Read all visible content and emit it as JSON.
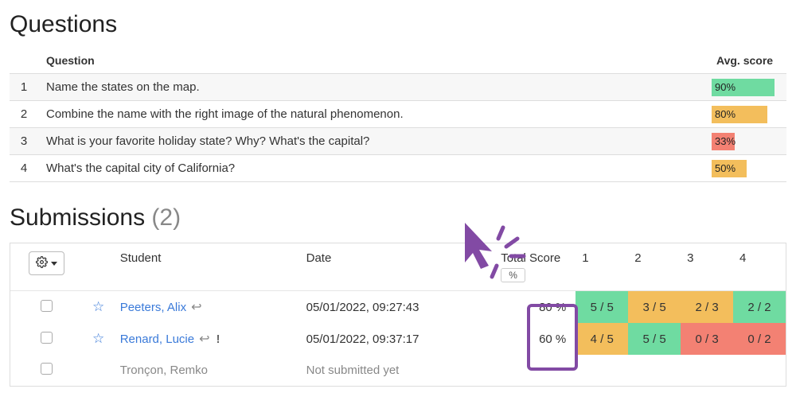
{
  "questions": {
    "heading": "Questions",
    "columns": {
      "question": "Question",
      "avg": "Avg. score"
    },
    "rows": [
      {
        "n": "1",
        "text": "Name the states on the map.",
        "avg": "90%",
        "pct": 90,
        "cls": "c-green"
      },
      {
        "n": "2",
        "text": "Combine the name with the right image of the natural phenomenon.",
        "avg": "80%",
        "pct": 80,
        "cls": "c-orange"
      },
      {
        "n": "3",
        "text": "What is your favorite holiday state? Why? What's the capital?",
        "avg": "33%",
        "pct": 33,
        "cls": "c-red"
      },
      {
        "n": "4",
        "text": "What's the capital city of California?",
        "avg": "50%",
        "pct": 50,
        "cls": "c-orange"
      }
    ]
  },
  "submissions": {
    "heading_prefix": "Submissions ",
    "count_display": "(2)",
    "columns": {
      "student": "Student",
      "date": "Date",
      "total": "Total Score",
      "percent_toggle": "%",
      "q1": "1",
      "q2": "2",
      "q3": "3",
      "q4": "4"
    },
    "rows": [
      {
        "student": "Peeters, Alix",
        "date": "05/01/2022, 09:27:43",
        "total": "80 %",
        "scores": [
          {
            "v": "5 / 5",
            "cls": "c-green"
          },
          {
            "v": "3 / 5",
            "cls": "c-orange"
          },
          {
            "v": "2 / 3",
            "cls": "c-orange"
          },
          {
            "v": "2 / 2",
            "cls": "c-green"
          }
        ],
        "warn": false
      },
      {
        "student": "Renard, Lucie",
        "date": "05/01/2022, 09:37:17",
        "total": "60 %",
        "scores": [
          {
            "v": "4 / 5",
            "cls": "c-orange"
          },
          {
            "v": "5 / 5",
            "cls": "c-green"
          },
          {
            "v": "0 / 3",
            "cls": "c-red"
          },
          {
            "v": "0 / 2",
            "cls": "c-red"
          }
        ],
        "warn": true
      },
      {
        "student": "Tronçon, Remko",
        "date": "Not submitted yet",
        "total": "",
        "scores": [],
        "not_submitted": true
      }
    ]
  }
}
